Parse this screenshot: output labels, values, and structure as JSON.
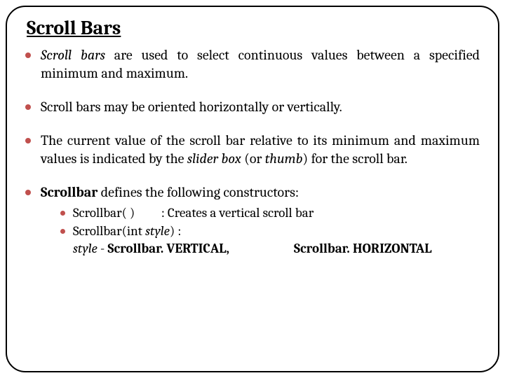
{
  "title": "Scroll Bars",
  "bullets": {
    "b1a": "Scroll bars",
    "b1b": " are used to select continuous values between a specified minimum and maximum.",
    "b2": "Scroll bars may be oriented horizontally or vertically.",
    "b3a": "The current value of the scroll bar relative to its minimum and maximum values is indicated by the ",
    "b3b": "slider box",
    "b3c": " (or ",
    "b3d": "thumb",
    "b3e": ") for the scroll bar.",
    "b4a": "Scrollbar",
    "b4b": " defines the following constructors:"
  },
  "sub": {
    "s1a": "Scrollbar( )",
    "s1gap": "         ",
    "s1b": ": Creates a vertical scroll bar",
    "s2a": "Scrollbar(int ",
    "s2b": "style",
    "s2c": ") :",
    "lineA": "style",
    "lineB": " - ",
    "lineC": "Scrollbar. VERTICAL,",
    "lineD": "Scrollbar. HORIZONTAL"
  }
}
